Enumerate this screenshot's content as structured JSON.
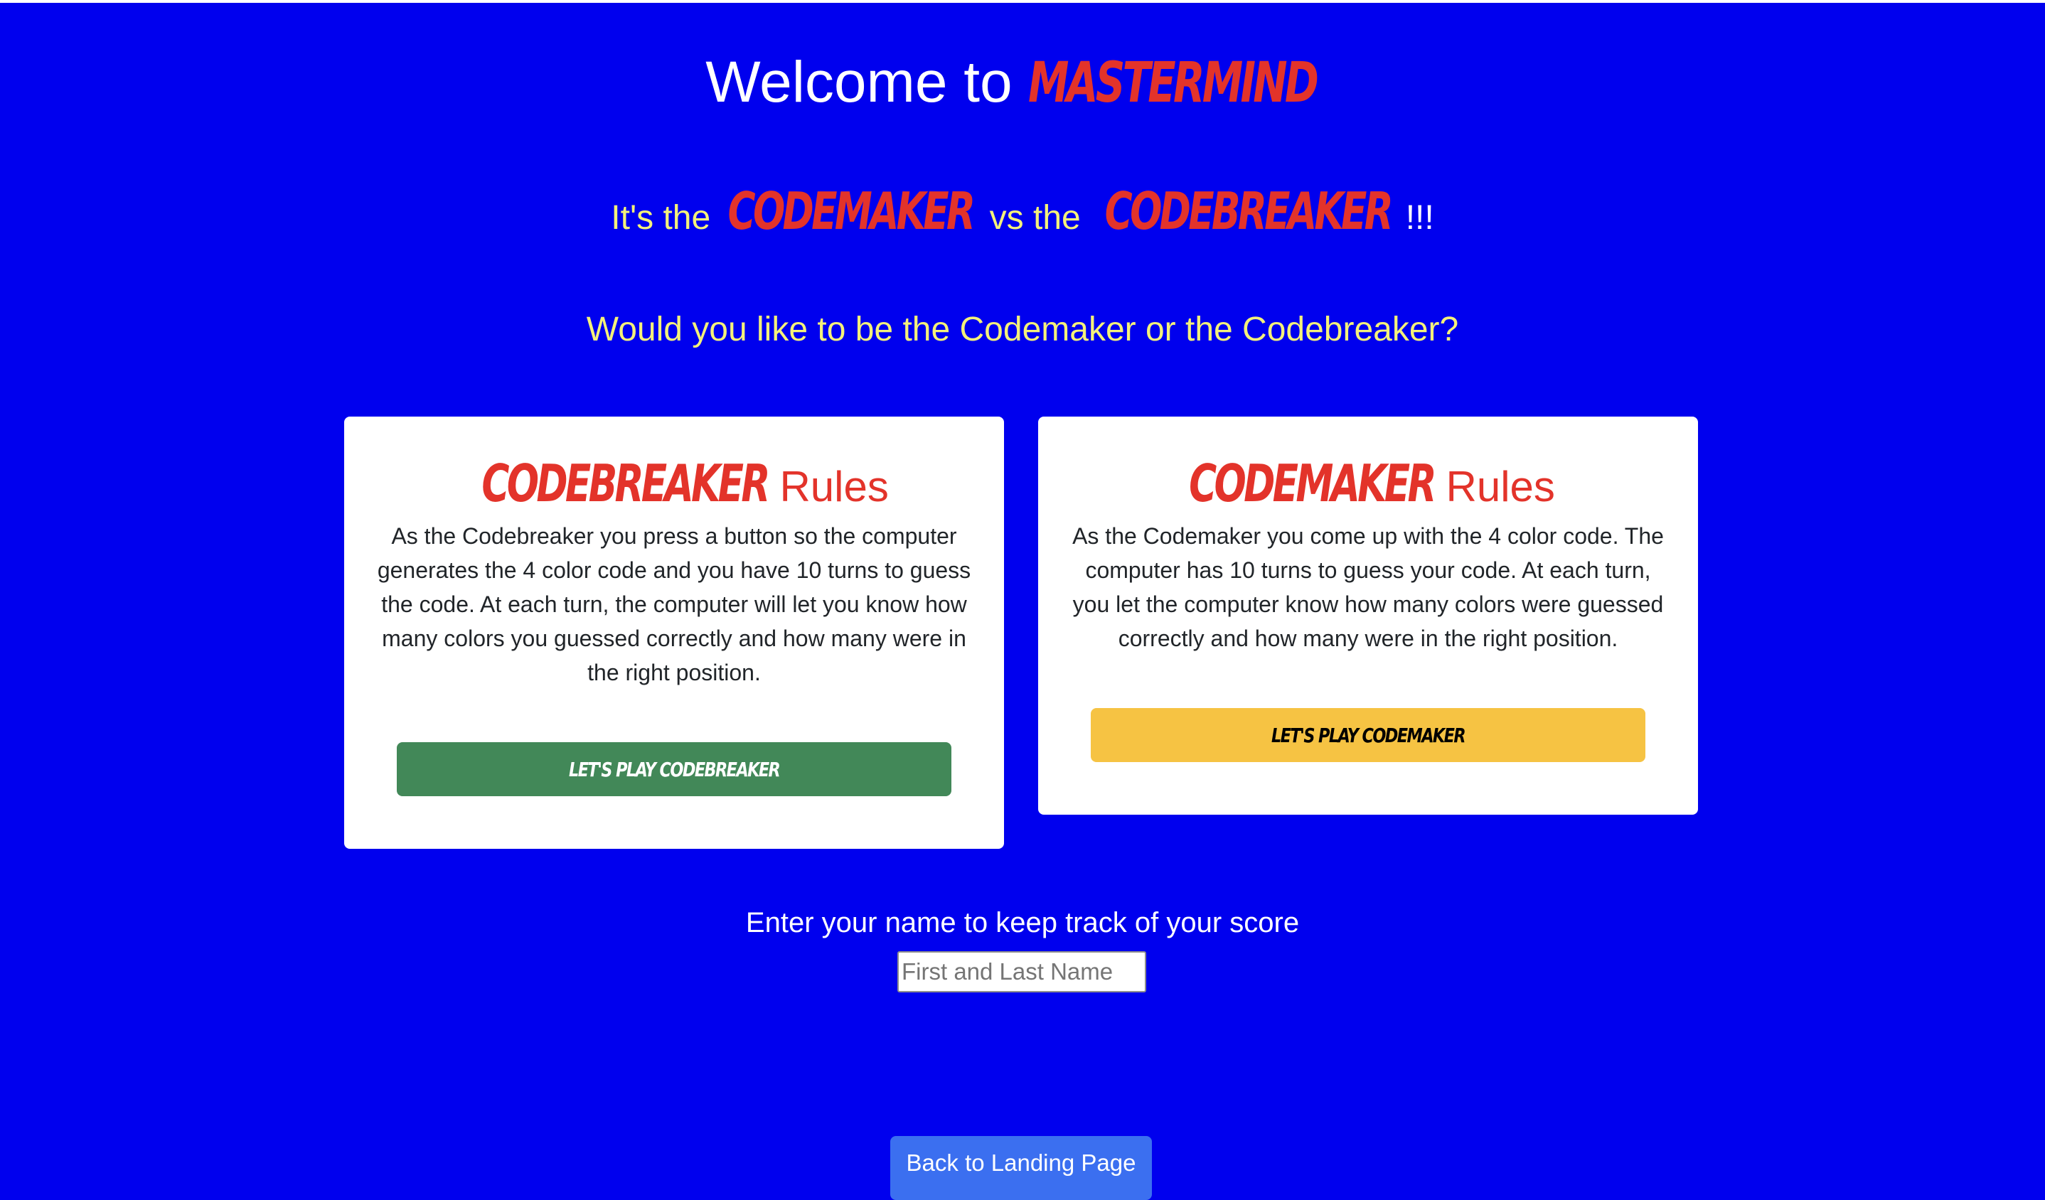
{
  "header": {
    "welcome_text": "Welcome to",
    "brand": "Mastermind"
  },
  "tagline": {
    "prefix": "It's the",
    "codemaker": "Codemaker",
    "middle": "vs the",
    "codebreaker": "Codebreaker",
    "suffix": "!!!"
  },
  "question": "Would you like to be the Codemaker or the Codebreaker?",
  "cards": {
    "codebreaker": {
      "title_brand": "Codebreaker",
      "title_suffix": "Rules",
      "body": "As the Codebreaker you press a button so the computer generates the 4 color code and you have 10 turns to guess the code. At each turn, the computer will let you know how many colors you guessed correctly and how many were in the right position.",
      "button_label": "Let's Play Codebreaker"
    },
    "codemaker": {
      "title_brand": "Codemaker",
      "title_suffix": "Rules",
      "body": "As the Codemaker you come up with the 4 color code. The computer has 10 turns to guess your code. At each turn, you let the computer know how many colors were guessed correctly and how many were in the right position.",
      "button_label": "Let's Play Codemaker"
    }
  },
  "name_entry": {
    "label": "Enter your name to keep track of your score",
    "placeholder": "First and Last Name",
    "value": ""
  },
  "footer": {
    "back_button_label": "Back to Landing Page"
  },
  "colors": {
    "background": "#0000ee",
    "brand_red": "#e3332a",
    "tagline_yellow": "#f4f17a",
    "codebreaker_button": "#428858",
    "codemaker_button": "#f6c343",
    "back_button": "#3b6ff0"
  }
}
